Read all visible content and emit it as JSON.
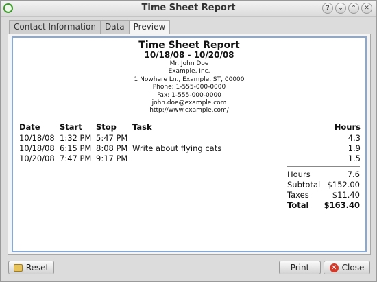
{
  "window": {
    "title": "Time Sheet Report",
    "buttons": [
      {
        "name": "help",
        "glyph": "?"
      },
      {
        "name": "shade",
        "glyph": "⌄"
      },
      {
        "name": "maximize",
        "glyph": "⌃"
      },
      {
        "name": "close",
        "glyph": "✕"
      }
    ]
  },
  "tabs": [
    "Contact Information",
    "Data",
    "Preview"
  ],
  "active_tab": "Preview",
  "report": {
    "title": "Time Sheet Report",
    "date_range": "10/18/08 - 10/20/08",
    "contact": [
      "Mr. John Doe",
      "Example, Inc.",
      "1 Nowhere Ln., Example, ST, 00000",
      "Phone: 1-555-000-0000",
      "Fax: 1-555-000-0000",
      "john.doe@example.com",
      "http://www.example.com/"
    ],
    "columns": [
      "Date",
      "Start",
      "Stop",
      "Task",
      "Hours"
    ],
    "entries": [
      {
        "date": "10/18/08",
        "start": "1:32 PM",
        "stop": "5:47 PM",
        "task": "",
        "hours": "4.3"
      },
      {
        "date": "10/18/08",
        "start": "6:15 PM",
        "stop": "8:08 PM",
        "task": "Write about flying cats",
        "hours": "1.9"
      },
      {
        "date": "10/20/08",
        "start": "7:47 PM",
        "stop": "9:17 PM",
        "task": "",
        "hours": "1.5"
      }
    ],
    "summary": {
      "hours_label": "Hours",
      "hours_value": "7.6",
      "subtotal_label": "Subtotal",
      "subtotal_value": "$152.00",
      "taxes_label": "Taxes",
      "taxes_value": "$11.40",
      "total_label": "Total",
      "total_value": "$163.40"
    }
  },
  "buttons": {
    "reset": "Reset",
    "print": "Print",
    "close": "Close"
  },
  "icons": {
    "app": "app-circle-icon",
    "reset": "broom-icon",
    "close": "close-circle-icon"
  },
  "colors": {
    "preview_border": "#86a9d6",
    "app_icon": "#3b9a2a",
    "close_icon": "#d33a2a"
  }
}
